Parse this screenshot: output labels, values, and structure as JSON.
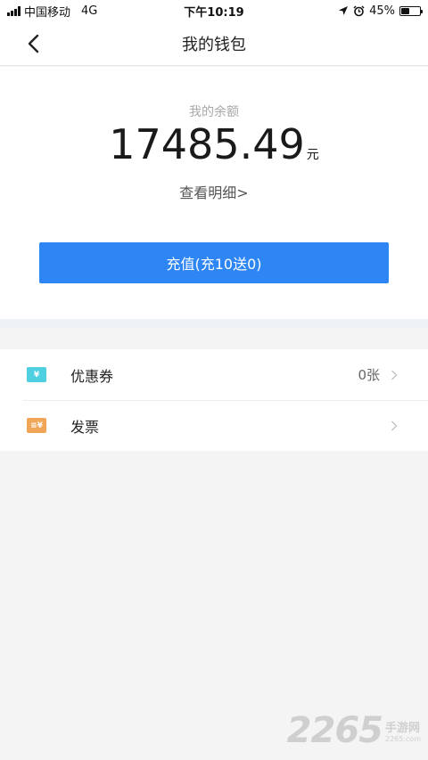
{
  "status_bar": {
    "carrier": "中国移动",
    "network": "4G",
    "time": "下午10:19",
    "battery_percent": "45%",
    "battery_level": 0.45
  },
  "nav": {
    "title": "我的钱包",
    "back_icon": "chevron-left-icon"
  },
  "balance": {
    "label": "我的余额",
    "amount": "17485.49",
    "unit": "元",
    "detail_link": "查看明细>"
  },
  "recharge_button": {
    "label": "充值(充10送0)",
    "color": "#2d86f3"
  },
  "list": {
    "items": [
      {
        "label": "优惠券",
        "value": "0张",
        "icon": "coupon-icon",
        "icon_color": "#4fd0e0",
        "icon_glyph": "¥"
      },
      {
        "label": "发票",
        "value": "",
        "icon": "invoice-icon",
        "icon_color": "#f0a656",
        "icon_glyph": "≡¥"
      }
    ]
  },
  "watermark": {
    "number": "2265",
    "site_name": "手游网",
    "site_url": "2265.com"
  }
}
